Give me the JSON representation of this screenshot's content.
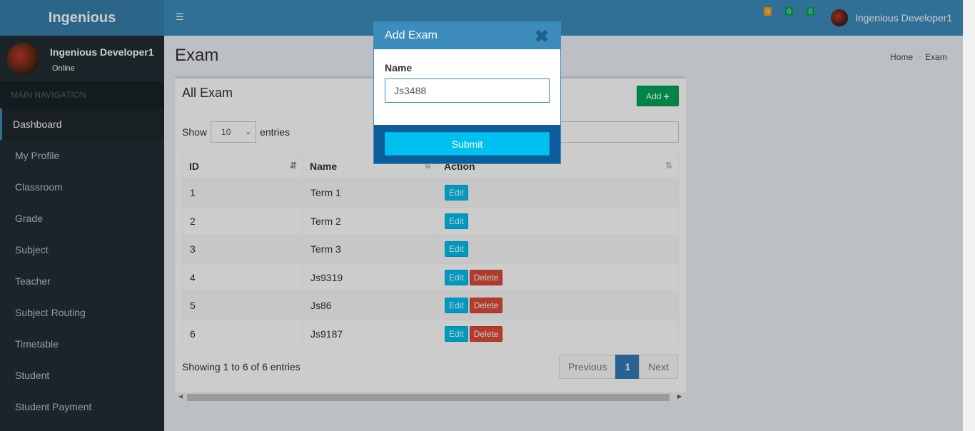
{
  "brand": "Ingenious",
  "header": {
    "toggle_icon": "menu-icon",
    "badges": [
      "0",
      "0",
      "0"
    ],
    "user_name": "Ingenious Developer1",
    "colors": {
      "topbar": "#3c8dbc",
      "logo": "#367fa9"
    }
  },
  "sidebar": {
    "user_name": "Ingenious Developer1",
    "status": "Online",
    "nav_header": "MAIN NAVIGATION",
    "items": [
      {
        "label": "Dashboard"
      },
      {
        "label": "My Profile"
      },
      {
        "label": "Classroom"
      },
      {
        "label": "Grade"
      },
      {
        "label": "Subject"
      },
      {
        "label": "Teacher"
      },
      {
        "label": "Subject Routing"
      },
      {
        "label": "Timetable"
      },
      {
        "label": "Student"
      },
      {
        "label": "Student Payment"
      }
    ]
  },
  "page": {
    "title": "Exam",
    "breadcrumb": [
      "Home",
      "Exam"
    ]
  },
  "box": {
    "title": "All Exam",
    "add_label": "Add",
    "show_label": "Show",
    "entries_select": "10",
    "entries_label": "entries",
    "columns": [
      "ID",
      "Name",
      "Action"
    ],
    "rows": [
      {
        "id": "1",
        "name": "Term 1",
        "edit": "Edit"
      },
      {
        "id": "2",
        "name": "Term 2",
        "edit": "Edit"
      },
      {
        "id": "3",
        "name": "Term 3",
        "edit": "Edit"
      },
      {
        "id": "4",
        "name": "Js9319",
        "edit": "Edit",
        "delete": "Delete"
      },
      {
        "id": "5",
        "name": "Js86",
        "edit": "Edit",
        "delete": "Delete"
      },
      {
        "id": "6",
        "name": "Js9187",
        "edit": "Edit",
        "delete": "Delete"
      }
    ],
    "info": "Showing 1 to 6 of 6 entries",
    "pager": {
      "previous": "Previous",
      "current": "1",
      "next": "Next"
    }
  },
  "modal": {
    "title": "Add Exam",
    "close_icon": "close-icon",
    "field_label": "Name",
    "field_value": "Js3488",
    "submit_label": "Submit"
  }
}
